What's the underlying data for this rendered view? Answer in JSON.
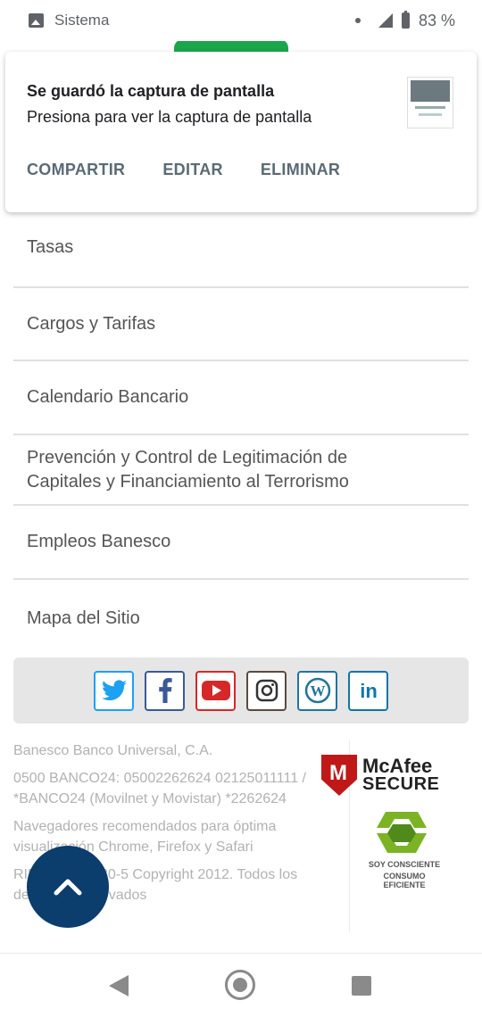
{
  "statusbar": {
    "app": "Sistema",
    "battery": "83 %"
  },
  "notification": {
    "title": "Se guardó la captura de pantalla",
    "text": "Presiona para ver la captura de pantalla",
    "actions": [
      "COMPARTIR",
      "EDITAR",
      "ELIMINAR"
    ]
  },
  "menu": [
    "Tasas",
    "Cargos y Tarifas",
    "Calendario Bancario",
    "Prevención y Control de Legitimación de Capitales y Financiamiento al Terrorismo",
    "Empleos Banesco",
    "Mapa del Sitio"
  ],
  "social": [
    {
      "name": "twitter-icon",
      "color": "#1da1f2"
    },
    {
      "name": "facebook-icon",
      "color": "#3b5998"
    },
    {
      "name": "youtube-icon",
      "color": "#d62828"
    },
    {
      "name": "instagram-icon",
      "color": "#5b4a3e"
    },
    {
      "name": "wordpress-icon",
      "color": "#21759b"
    },
    {
      "name": "linkedin-icon",
      "color": "#0e76a8"
    }
  ],
  "footer": {
    "company": "Banesco Banco Universal, C.A.",
    "phones": "0500 BANCO24: 05002262624 02125011111 / *BANCO24 (Movilnet y Movistar) *2262624",
    "browsers": "Navegadores recomendados para óptima visualización Chrome, Firefox y Safari",
    "rif": "RIF J-07013380-5 Copyright 2012. Todos los derechos reservados",
    "mcafee_brand": "McAfee",
    "mcafee_secure": "SECURE",
    "eco_line1": "SOY CONSCIENTE",
    "eco_line2": "CONSUMO EFICIENTE"
  }
}
